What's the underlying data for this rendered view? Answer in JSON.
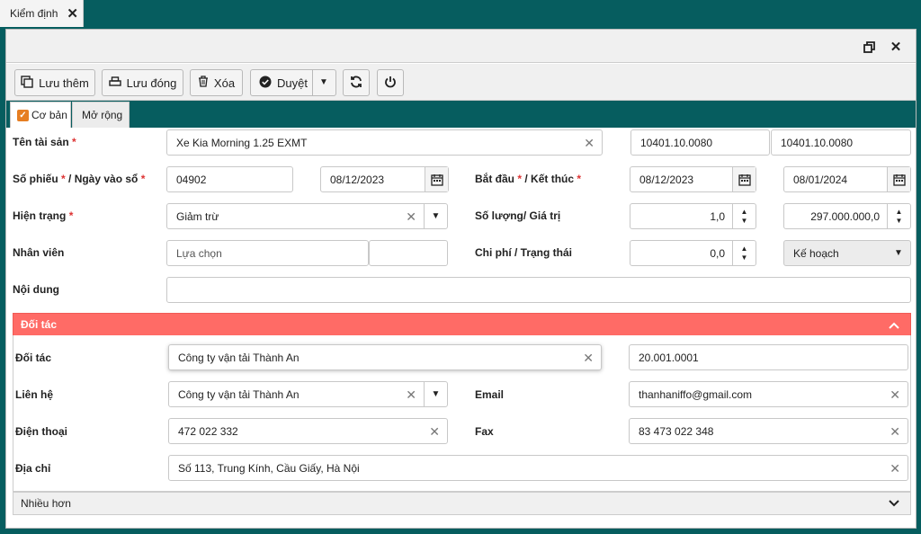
{
  "top_tab": {
    "label": "Kiểm định",
    "close": "✕"
  },
  "window": {
    "restore_icon": "restore-icon",
    "close": "✕"
  },
  "toolbar": {
    "save_more": "Lưu thêm",
    "save_close": "Lưu đóng",
    "delete": "Xóa",
    "approve": "Duyệt"
  },
  "tabs": {
    "basic": "Cơ bản",
    "extended": "Mở rộng"
  },
  "form": {
    "asset_label": "Tên tài sản",
    "asset_value": "Xe Kia Morning 1.25 EXMT",
    "asset_code1": "10401.10.0080",
    "asset_code2": "10401.10.0080",
    "voucher_label_a": "Số phiếu",
    "voucher_label_b": " / Ngày vào sổ",
    "voucher_value": "04902",
    "entry_date": "08/12/2023",
    "start_end_label_a": "Bắt đầu",
    "start_end_label_b": " / Kết thúc",
    "start_date": "08/12/2023",
    "end_date": "08/01/2024",
    "status_label": "Hiện trạng",
    "status_value": "Giảm trừ",
    "qty_label": "Số lượng/ Giá trị",
    "qty_value": "1,0",
    "amount_value": "297.000.000,0",
    "staff_label": "Nhân viên",
    "staff_placeholder": "Lựa chọn",
    "cost_label": "Chi phí / Trạng thái",
    "cost_value": "0,0",
    "state_value": "Kế hoạch",
    "content_label": "Nội dung",
    "content_value": ""
  },
  "partner": {
    "section_title": "Đối tác",
    "partner_label": "Đối tác",
    "partner_value": "Công ty vận tải Thành An",
    "partner_code": "20.001.0001",
    "contact_label": "Liên hệ",
    "contact_value": "Công ty vận tải Thành An",
    "email_label": "Email",
    "email_value": "thanhaniffo@gmail.com",
    "phone_label": "Điện thoại",
    "phone_value": "472 022 332",
    "fax_label": "Fax",
    "fax_value": "83 473 022 348",
    "address_label": "Địa chỉ",
    "address_value": "Số 113, Trung Kính, Cầu Giấy, Hà Nội",
    "more_label": "Nhiều hơn"
  },
  "colors": {
    "accent": "#065d5f",
    "section": "#ff6b66",
    "required": "#d33",
    "check": "#e67e22"
  }
}
